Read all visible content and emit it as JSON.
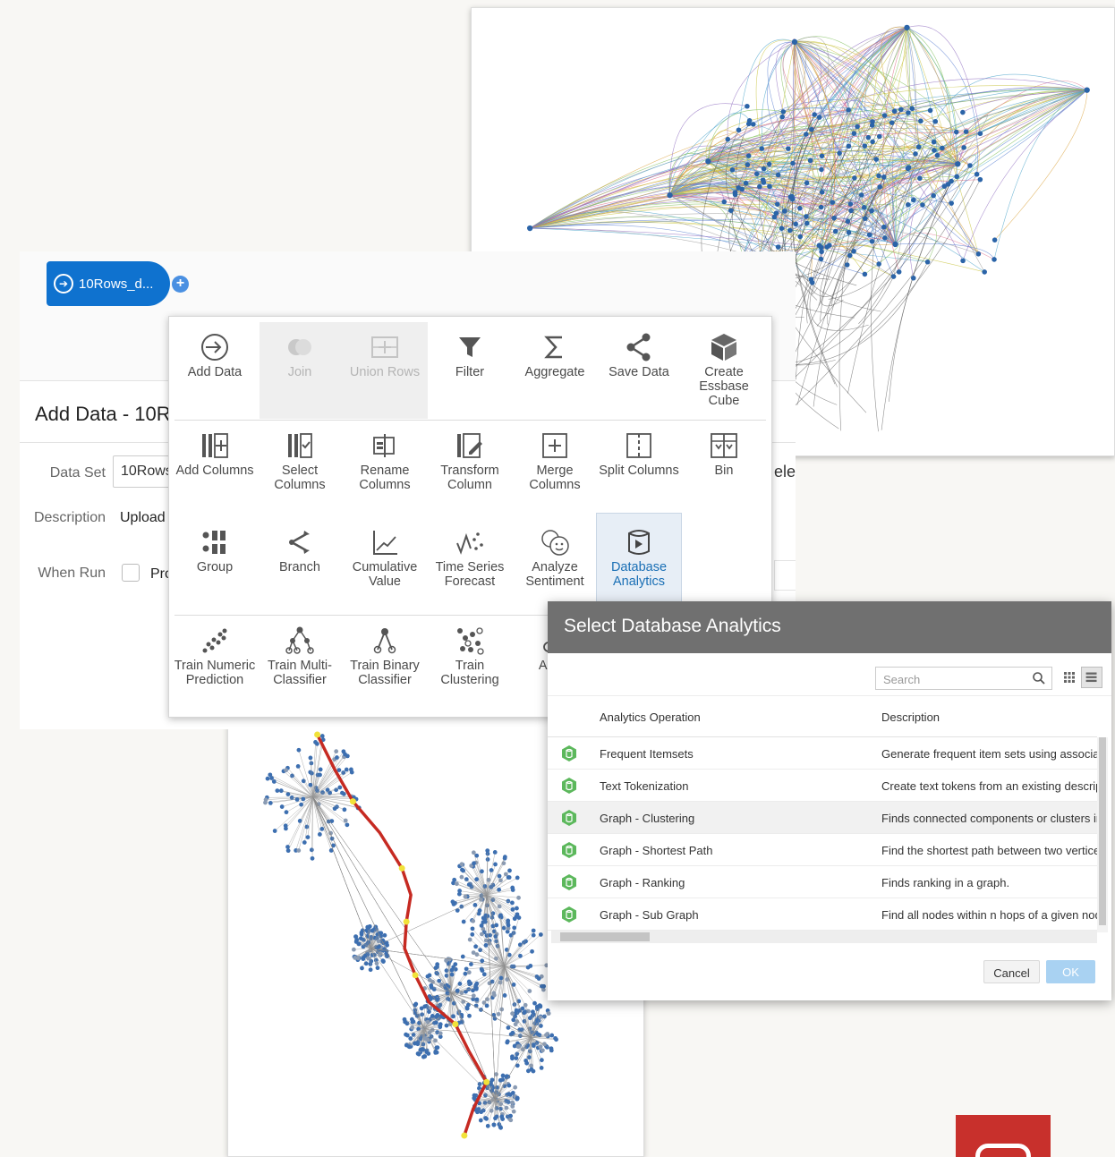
{
  "flow_node": {
    "label": "10Rows_d..."
  },
  "properties": {
    "title": "Add Data - 10R",
    "data_set_label": "Data Set",
    "data_set_value": "10Rows",
    "description_label": "Description",
    "description_value": "Upload",
    "when_run_label": "When Run",
    "when_run_option": "Pro",
    "truncated_right": "ele"
  },
  "palette": {
    "rows": [
      [
        {
          "label": "Add Data",
          "icon": "add-data-icon",
          "state": "enabled"
        },
        {
          "label": "Join",
          "icon": "join-icon",
          "state": "disabled"
        },
        {
          "label": "Union Rows",
          "icon": "union-rows-icon",
          "state": "disabled"
        },
        {
          "label": "Filter",
          "icon": "filter-icon",
          "state": "enabled"
        },
        {
          "label": "Aggregate",
          "icon": "sigma-icon",
          "state": "enabled"
        },
        {
          "label": "Save Data",
          "icon": "share-icon",
          "state": "enabled"
        },
        {
          "label": "Create Essbase Cube",
          "icon": "cube-icon",
          "state": "enabled"
        }
      ],
      [
        {
          "label": "Add Columns",
          "icon": "add-columns-icon",
          "state": "enabled"
        },
        {
          "label": "Select Columns",
          "icon": "select-columns-icon",
          "state": "enabled"
        },
        {
          "label": "Rename Columns",
          "icon": "rename-columns-icon",
          "state": "enabled"
        },
        {
          "label": "Transform Column",
          "icon": "transform-column-icon",
          "state": "enabled"
        },
        {
          "label": "Merge Columns",
          "icon": "merge-columns-icon",
          "state": "enabled"
        },
        {
          "label": "Split Columns",
          "icon": "split-columns-icon",
          "state": "enabled"
        },
        {
          "label": "Bin",
          "icon": "bin-icon",
          "state": "enabled"
        }
      ],
      [
        {
          "label": "Group",
          "icon": "group-icon",
          "state": "enabled"
        },
        {
          "label": "Branch",
          "icon": "branch-icon",
          "state": "enabled"
        },
        {
          "label": "Cumulative Value",
          "icon": "cumulative-icon",
          "state": "enabled"
        },
        {
          "label": "Time Series Forecast",
          "icon": "forecast-icon",
          "state": "enabled"
        },
        {
          "label": "Analyze Sentiment",
          "icon": "sentiment-icon",
          "state": "enabled"
        },
        {
          "label": "Database Analytics",
          "icon": "database-analytics-icon",
          "state": "selected"
        }
      ],
      [
        {
          "label": "Train Numeric Prediction",
          "icon": "scatter-icon",
          "state": "enabled"
        },
        {
          "label": "Train Multi-Classifier",
          "icon": "tree-icon",
          "state": "enabled"
        },
        {
          "label": "Train Binary Classifier",
          "icon": "binary-tree-icon",
          "state": "enabled"
        },
        {
          "label": "Train Clustering",
          "icon": "clustering-icon",
          "state": "enabled"
        },
        {
          "label": "Apply",
          "icon": "apply-icon",
          "state": "enabled"
        }
      ]
    ]
  },
  "dialog": {
    "title": "Select Database Analytics",
    "search_placeholder": "Search",
    "columns": [
      "Analytics Operation",
      "Description"
    ],
    "rows": [
      {
        "operation": "Frequent Itemsets",
        "description": "Generate frequent item sets using associati"
      },
      {
        "operation": "Text Tokenization",
        "description": "Create text tokens from an existing descript"
      },
      {
        "operation": "Graph - Clustering",
        "description": "Finds connected components or clusters in"
      },
      {
        "operation": "Graph - Shortest Path",
        "description": "Find the shortest path between two vertices"
      },
      {
        "operation": "Graph - Ranking",
        "description": "Finds ranking in a graph."
      },
      {
        "operation": "Graph - Sub Graph",
        "description": "Find all nodes within n hops of a given node"
      }
    ],
    "highlighted_row": 2,
    "cancel_label": "Cancel",
    "ok_label": "OK",
    "accent_color": "#5cb85c"
  }
}
